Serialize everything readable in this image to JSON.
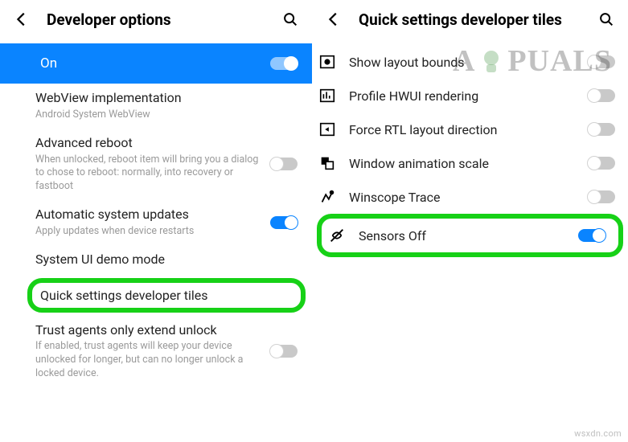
{
  "left": {
    "header": "Developer options",
    "on_label": "On",
    "items": [
      {
        "title": "WebView implementation",
        "sub": "Android System WebView",
        "toggle": null
      },
      {
        "title": "Advanced reboot",
        "sub": "When unlocked, reboot item will bring you a dialog to chose to reboot: normally, into recovery or fastboot",
        "toggle": "off"
      },
      {
        "title": "Automatic system updates",
        "sub": "Apply updates when device restarts",
        "toggle": "on"
      },
      {
        "title": "System UI demo mode",
        "sub": "",
        "toggle": null
      },
      {
        "title": "Quick settings developer tiles",
        "sub": "",
        "toggle": null,
        "highlighted": true
      },
      {
        "title": "Trust agents only extend unlock",
        "sub": "If enabled, trust agents will keep your device unlocked for longer, but can no longer unlock a locked device.",
        "toggle": "off"
      }
    ]
  },
  "right": {
    "header": "Quick settings developer tiles",
    "items": [
      {
        "icon": "layout-bounds-icon",
        "title": "Show layout bounds",
        "toggle": "off"
      },
      {
        "icon": "profile-hwui-icon",
        "title": "Profile HWUI rendering",
        "toggle": "off"
      },
      {
        "icon": "rtl-icon",
        "title": "Force RTL layout direction",
        "toggle": "off"
      },
      {
        "icon": "animation-scale-icon",
        "title": "Window animation scale",
        "toggle": "off"
      },
      {
        "icon": "winscope-icon",
        "title": "Winscope Trace",
        "toggle": "off"
      },
      {
        "icon": "sensors-off-icon",
        "title": "Sensors Off",
        "toggle": "on",
        "highlighted": true
      }
    ]
  },
  "watermark": {
    "prefix": "A",
    "suffix": "PUALS"
  },
  "footer": "wsxdn.com"
}
